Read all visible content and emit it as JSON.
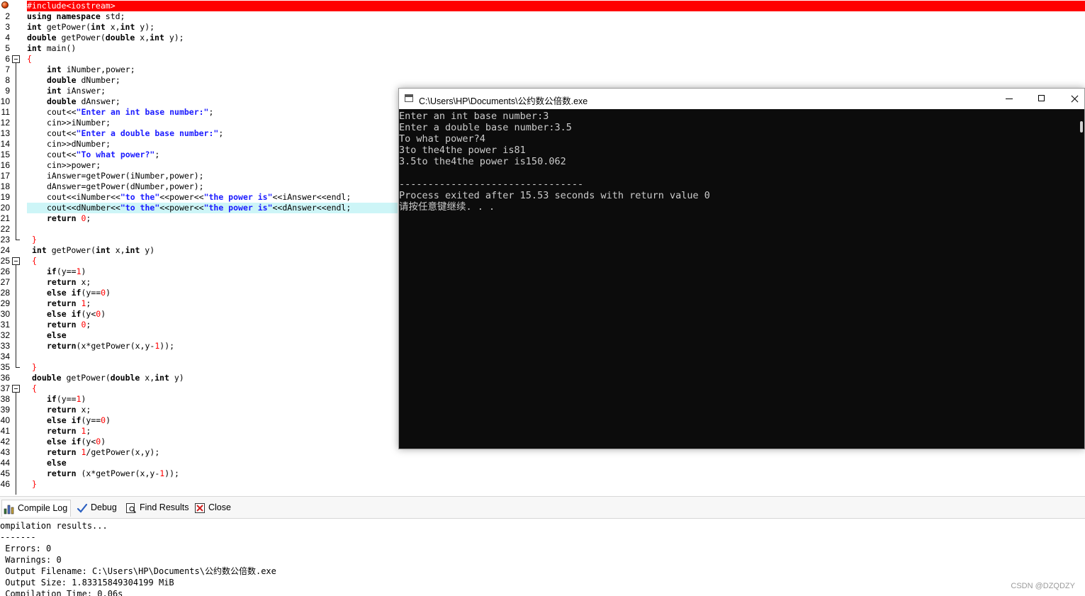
{
  "editor": {
    "line_numbers": [
      "1",
      "2",
      "3",
      "4",
      "5",
      "6",
      "7",
      "8",
      "9",
      "10",
      "11",
      "12",
      "13",
      "14",
      "15",
      "16",
      "17",
      "18",
      "19",
      "20",
      "21",
      "22",
      "23",
      "24",
      "25",
      "26",
      "27",
      "28",
      "29",
      "30",
      "31",
      "32",
      "33",
      "34",
      "35",
      "36",
      "37",
      "38",
      "39",
      "40",
      "41",
      "42",
      "43",
      "44",
      "45",
      "46"
    ],
    "code": {
      "l1": "#include<iostream>",
      "l2a": "using namespace",
      "l2b": " std;",
      "l3a": "int",
      "l3b": " getPower(",
      "l3c": "int",
      "l3d": " x,",
      "l3e": "int",
      "l3f": " y);",
      "l4a": "double",
      "l4b": " getPower(",
      "l4c": "double",
      "l4d": " x,",
      "l4e": "int",
      "l4f": " y);",
      "l5a": "int",
      "l5b": " main()",
      "l6": "{",
      "l7a": "int",
      "l7b": " iNumber,power;",
      "l8a": "double",
      "l8b": " dNumber;",
      "l9a": "int",
      "l9b": " iAnswer;",
      "l10a": "double",
      "l10b": " dAnswer;",
      "l11a": "cout<<",
      "l11b": "\"Enter an int base number:\"",
      "l11c": ";",
      "l12": "cin>>iNumber;",
      "l13a": "cout<<",
      "l13b": "\"Enter a double base number:\"",
      "l13c": ";",
      "l14": "cin>>dNumber;",
      "l15a": "cout<<",
      "l15b": "\"To what power?\"",
      "l15c": ";",
      "l16": "cin>>power;",
      "l17": "iAnswer=getPower(iNumber,power);",
      "l18": "dAnswer=getPower(dNumber,power);",
      "l19a": "cout<<iNumber<<",
      "l19b": "\"to the\"",
      "l19c": "<<power<<",
      "l19d": "\"the power is\"",
      "l19e": "<<iAnswer<<endl;",
      "l20a": "cout<<dNumber<<",
      "l20b": "\"to the\"",
      "l20c": "<<power<<",
      "l20d": "\"the power is\"",
      "l20e": "<<dAnswer<<endl;",
      "l21a": "return",
      "l21b": " 0",
      "l21c": ";",
      "l23": "}",
      "l24a": "int",
      "l24b": " getPower(",
      "l24c": "int",
      "l24d": " x,",
      "l24e": "int",
      "l24f": " y)",
      "l25": "{",
      "l26a": "if",
      "l26b": "(y==",
      "l26c": "1",
      "l26d": ")",
      "l27a": "return",
      "l27b": " x;",
      "l28a": "else if",
      "l28b": "(y==",
      "l28c": "0",
      "l28d": ")",
      "l29a": "return",
      "l29b": " 1",
      "l29c": ";",
      "l30a": "else if",
      "l30b": "(y<",
      "l30c": "0",
      "l30d": ")",
      "l31a": "return",
      "l31b": " 0",
      "l31c": ";",
      "l32": "else",
      "l33a": "return",
      "l33b": "(x*getPower(x,y-",
      "l33c": "1",
      "l33d": "));",
      "l35": "}",
      "l36a": "double",
      "l36b": " getPower(",
      "l36c": "double",
      "l36d": " x,",
      "l36e": "int",
      "l36f": " y)",
      "l37": "{",
      "l38a": "if",
      "l38b": "(y==",
      "l38c": "1",
      "l38d": ")",
      "l39a": "return",
      "l39b": " x;",
      "l40a": "else if",
      "l40b": "(y==",
      "l40c": "0",
      "l40d": ")",
      "l41a": "return",
      "l41b": " 1",
      "l41c": ";",
      "l42a": "else if",
      "l42b": "(y<",
      "l42c": "0",
      "l42d": ")",
      "l43a": "return",
      "l43b": " 1",
      "l43c": "/getPower(x,y);",
      "l44": "else",
      "l45a": "return",
      "l45b": " (x*getPower(x,y-",
      "l45c": "1",
      "l45d": "));",
      "l46": "}"
    }
  },
  "console": {
    "title": "C:\\Users\\HP\\Documents\\公约数公倍数.exe",
    "lines": [
      "Enter an int base number:3",
      "Enter a double base number:3.5",
      "To what power?4",
      "3to the4the power is81",
      "3.5to the4the power is150.062",
      "",
      "--------------------------------",
      "Process exited after 15.53 seconds with return value 0",
      "请按任意键继续. . ."
    ]
  },
  "tabs": [
    {
      "label": "Compile Log",
      "icon": "bar-chart-icon"
    },
    {
      "label": "Debug",
      "icon": "check-icon"
    },
    {
      "label": "Find Results",
      "icon": "find-icon"
    },
    {
      "label": "Close",
      "icon": "close-icon"
    }
  ],
  "log": {
    "lines": [
      "ompilation results...",
      "-------",
      " Errors: 0",
      " Warnings: 0",
      " Output Filename: C:\\Users\\HP\\Documents\\公约数公倍数.exe",
      " Output Size: 1.83315849304199 MiB",
      " Compilation Time: 0.06s"
    ]
  },
  "watermark": "CSDN @DZQDZY",
  "colors": {
    "breakpoint_line": "#ff0000",
    "current_line": "#cdf5f7",
    "string": "#1a1aff",
    "number": "#ff0000",
    "console_bg": "#0c0c0c",
    "console_text": "#cccccc"
  }
}
